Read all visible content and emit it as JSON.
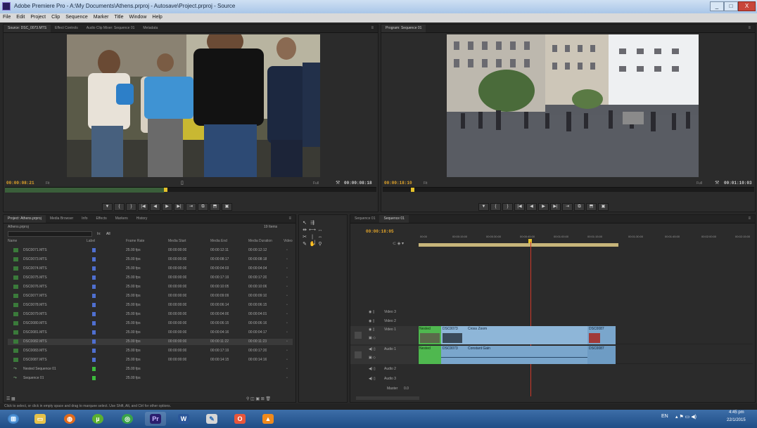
{
  "window": {
    "title": "Adobe Premiere Pro - A:\\My Documents\\Athens.prproj - Autosave\\Project.prproj - Source",
    "minimize": "_",
    "maximize": "□",
    "close": "X"
  },
  "menu": [
    "File",
    "Edit",
    "Project",
    "Clip",
    "Sequence",
    "Marker",
    "Title",
    "Window",
    "Help"
  ],
  "source_monitor": {
    "tabs": [
      "Source: DSC_0073.MTS",
      "Effect Controls",
      "Audio Clip Mixer: Sequence 01",
      "Metadata"
    ],
    "timecode_left": "00:00:08:21",
    "fit": "Fit",
    "timecode_right": "00:00:08:18",
    "resolution": "Full"
  },
  "program_monitor": {
    "tabs": [
      "Program: Sequence 01"
    ],
    "timecode_left": "00:00:18:10",
    "fit": "Fit",
    "timecode_right": "00:01:10:03",
    "resolution": "Full"
  },
  "transport_source": [
    "▼",
    "{",
    "}",
    "|◀",
    "◀",
    "▶",
    "▶|",
    "⇥",
    "⧉",
    "⬒",
    "▣"
  ],
  "transport_program": [
    "▼",
    "{",
    "}",
    "|◀",
    "◀",
    "▶",
    "▶|",
    "⇥",
    "⧉",
    "⬒",
    "▣"
  ],
  "project": {
    "tabs": [
      "Project: Athens.prproj",
      "Media Browser",
      "Info",
      "Effects",
      "Markers",
      "History"
    ],
    "item_count": "19 Items",
    "path": "Athens.prproj",
    "search_placeholder": "",
    "in_label": "In:",
    "in_value": "All",
    "columns": [
      "Name",
      "Label",
      "Frame Rate",
      "Media Start",
      "Media End",
      "Media Duration",
      "Video"
    ],
    "rows": [
      {
        "name": "DSC0071.MTS",
        "frame_rate": "25.00 fps",
        "start": "00:00:00:00",
        "end": "00:00:12:11",
        "duration": "00:00:12:12",
        "type": "clip",
        "label": "#4f6fd0"
      },
      {
        "name": "DSC0073.MTS",
        "frame_rate": "25.00 fps",
        "start": "00:00:00:00",
        "end": "00:00:08:17",
        "duration": "00:00:08:18",
        "type": "clip",
        "label": "#4f6fd0"
      },
      {
        "name": "DSC0074.MTS",
        "frame_rate": "25.00 fps",
        "start": "00:00:00:00",
        "end": "00:00:04:03",
        "duration": "00:00:04:04",
        "type": "clip",
        "label": "#4f6fd0"
      },
      {
        "name": "DSC0075.MTS",
        "frame_rate": "25.00 fps",
        "start": "00:00:00:00",
        "end": "00:00:17:19",
        "duration": "00:00:17:20",
        "type": "clip",
        "label": "#4f6fd0"
      },
      {
        "name": "DSC0076.MTS",
        "frame_rate": "25.00 fps",
        "start": "00:00:00:00",
        "end": "00:00:10:05",
        "duration": "00:00:10:06",
        "type": "clip",
        "label": "#4f6fd0"
      },
      {
        "name": "DSC0077.MTS",
        "frame_rate": "25.00 fps",
        "start": "00:00:00:00",
        "end": "00:00:09:09",
        "duration": "00:00:09:10",
        "type": "clip",
        "label": "#4f6fd0"
      },
      {
        "name": "DSC0078.MTS",
        "frame_rate": "25.00 fps",
        "start": "00:00:00:00",
        "end": "00:00:06:14",
        "duration": "00:00:06:15",
        "type": "clip",
        "label": "#4f6fd0"
      },
      {
        "name": "DSC0079.MTS",
        "frame_rate": "25.00 fps",
        "start": "00:00:00:00",
        "end": "00:00:04:00",
        "duration": "00:00:04:01",
        "type": "clip",
        "label": "#4f6fd0"
      },
      {
        "name": "DSC0080.MTS",
        "frame_rate": "25.00 fps",
        "start": "00:00:00:00",
        "end": "00:00:06:15",
        "duration": "00:00:06:16",
        "type": "clip",
        "label": "#4f6fd0"
      },
      {
        "name": "DSC0081.MTS",
        "frame_rate": "25.00 fps",
        "start": "00:00:00:00",
        "end": "00:00:04:16",
        "duration": "00:00:04:17",
        "type": "clip",
        "label": "#4f6fd0"
      },
      {
        "name": "DSC0082.MTS",
        "frame_rate": "25.00 fps",
        "start": "00:00:00:00",
        "end": "00:00:11:22",
        "duration": "00:00:11:23",
        "type": "clip",
        "label": "#4f6fd0"
      },
      {
        "name": "DSC0083.MTS",
        "frame_rate": "25.00 fps",
        "start": "00:00:00:00",
        "end": "00:00:17:19",
        "duration": "00:00:17:20",
        "type": "clip",
        "label": "#4f6fd0"
      },
      {
        "name": "DSC0087.MTS",
        "frame_rate": "25.00 fps",
        "start": "00:00:00:00",
        "end": "00:00:14:15",
        "duration": "00:00:14:16",
        "type": "clip",
        "label": "#4f6fd0"
      },
      {
        "name": "Nested Sequence 01",
        "frame_rate": "25.00 fps",
        "start": "",
        "end": "",
        "duration": "",
        "type": "sequence",
        "label": "#3dbb3d"
      },
      {
        "name": "Sequence 01",
        "frame_rate": "25.00 fps",
        "start": "",
        "end": "",
        "duration": "",
        "type": "sequence",
        "label": "#3dbb3d"
      }
    ],
    "selected_row": 10
  },
  "timeline": {
    "tabs": [
      "Sequence 01",
      "Sequence 01"
    ],
    "timecode": "00:00:18:05",
    "ruler": [
      "00:00",
      "00:00:15:00",
      "00:00:30:00",
      "00:00:45:00",
      "00:01:00:00",
      "00:01:15:00",
      "00:01:30:00",
      "00:01:45:00",
      "00:02:00:00",
      "00:02:15:00"
    ],
    "tracks": {
      "v3": "Video 3",
      "v2": "Video 2",
      "v1": "Video 1",
      "a1": "Audio 1",
      "a2": "Audio 2",
      "a3": "Audio 3",
      "master": "Master",
      "master_value": "0.0"
    },
    "clips": {
      "v_label_a": "Nested",
      "v_label_b": "DSC0073",
      "v_label_c": "Cross Zoom",
      "v_label_end": "DSC0087",
      "a_label_a": "Nested",
      "a_label_b": "DSC0073",
      "a_label_c": "Constant Gain",
      "a_label_end": "DSC0087"
    }
  },
  "status": "Click to select, or click in empty space and drag to marquee select. Use Shift, Alt, and Ctrl for other options.",
  "taskbar": {
    "apps": [
      "start",
      "explorer",
      "firefox",
      "utorrent",
      "chrome",
      "premiere",
      "word",
      "paint",
      "office",
      "vlc"
    ],
    "lang": "EN",
    "time": "4:45 pm",
    "date": "22/1/2015"
  },
  "colors": {
    "accent_timecode": "#e3a52a",
    "clip_video": "#8eb6d8",
    "clip_audio": "#7aa6cc",
    "clip_nested": "#4fb84f",
    "playhead": "#d03a2a",
    "workarea": "#c7b57a"
  }
}
